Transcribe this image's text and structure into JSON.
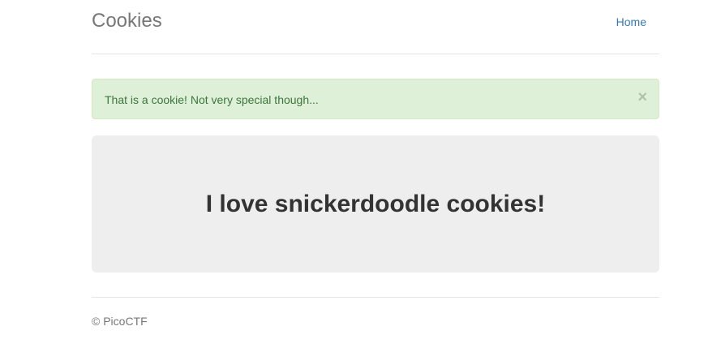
{
  "header": {
    "brand": "Cookies",
    "nav": [
      {
        "label": "Home"
      }
    ]
  },
  "alert": {
    "message": "That is a cookie! Not very special though...",
    "close_glyph": "×"
  },
  "jumbotron": {
    "heading": "I love snickerdoodle cookies!"
  },
  "footer": {
    "text": "© PicoCTF"
  },
  "colors": {
    "link": "#337ab7",
    "alert_bg": "#dff0d8",
    "alert_text": "#3c763d",
    "jumbotron_bg": "#eeeeee"
  }
}
